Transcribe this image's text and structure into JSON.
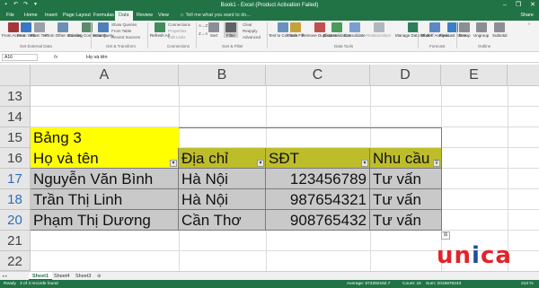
{
  "window": {
    "title": "Book1 - Excel (Product Activation Failed)",
    "controls": [
      "–",
      "❐",
      "✕"
    ]
  },
  "tabs": [
    "File",
    "Home",
    "Insert",
    "Page Layout",
    "Formulas",
    "Data",
    "Review",
    "View"
  ],
  "active_tab": "Data",
  "tell_me": "Tell me what you want to do...",
  "share": "Share",
  "ribbon": {
    "get_external": [
      "From Access",
      "From Web",
      "From Text",
      "From Other Sources",
      "Existing Connections"
    ],
    "new_query": "New Query",
    "query_small": [
      "Show Queries",
      "From Table",
      "Recent Sources"
    ],
    "refresh": "Refresh All",
    "conn_small": [
      "Connections",
      "Properties",
      "Edit Links"
    ],
    "sort_small": [
      "A→Z",
      "Z→A"
    ],
    "sort": "Sort",
    "filter": "Filter",
    "filter_small": [
      "Clear",
      "Reapply",
      "Advanced"
    ],
    "text_to_columns": "Text to Columns",
    "flash_fill": "Flash Fill",
    "remove_duplicates": "Remove Duplicates",
    "data_validation": "Data Validation",
    "consolidate": "Consolidate",
    "relationships": "Relationships",
    "manage_model": "Manage Data Model",
    "what_if": "What-If Analysis",
    "forecast_sheet": "Forecast Sheet",
    "group": "Group",
    "ungroup": "Ungroup",
    "subtotal": "Subtotal",
    "group_labels": [
      "Get External Data",
      "Get & Transform",
      "Connections",
      "Sort & Filter",
      "Data Tools",
      "Forecast",
      "Outline"
    ]
  },
  "formula_bar": {
    "name_box": "A16",
    "fx": "fx",
    "content": "Họ và tên"
  },
  "columns": [
    "A",
    "B",
    "C",
    "D",
    "E"
  ],
  "rows": [
    "13",
    "14",
    "15",
    "16",
    "17",
    "18",
    "19",
    "20",
    "21",
    "22"
  ],
  "cells": {
    "a15": "Bảng 3",
    "a16": "Họ và tên",
    "b16": "Địa chỉ",
    "c16": "SĐT",
    "d16": "Nhu cầu",
    "data_rows": [
      [
        "Nguyễn Văn Bình",
        "Hà Nội",
        "123456789",
        "Tư vấn"
      ],
      [
        "Trần Thị Linh",
        "Hà Nội",
        "987654321",
        "Tư vấn"
      ],
      [
        "Phạm Thị Dương",
        "Cần Thơ",
        "908765432",
        "Tư vấn"
      ]
    ]
  },
  "sheets": [
    "Sheet1",
    "Sheet4",
    "Sheet3"
  ],
  "active_sheet": "Sheet1",
  "status": {
    "left": "Ready",
    "records": "3 of 4 records found",
    "average": "Average: 673292162.7",
    "count": "Count: 16",
    "sum": "Sum: 2019878243",
    "zoom": "210 %"
  },
  "logo": {
    "text_red": "un",
    "text_blue": "i",
    "text_red2": "ca"
  },
  "colors": {
    "excel_green": "#217346",
    "header_yellow": "#ffff00",
    "header_olive": "#bdbd2a",
    "row_gray": "#c9c9c9",
    "filtered_row_blue": "#2f6ebd",
    "logo_red": "#e2232a",
    "logo_blue": "#1e4f9c"
  }
}
